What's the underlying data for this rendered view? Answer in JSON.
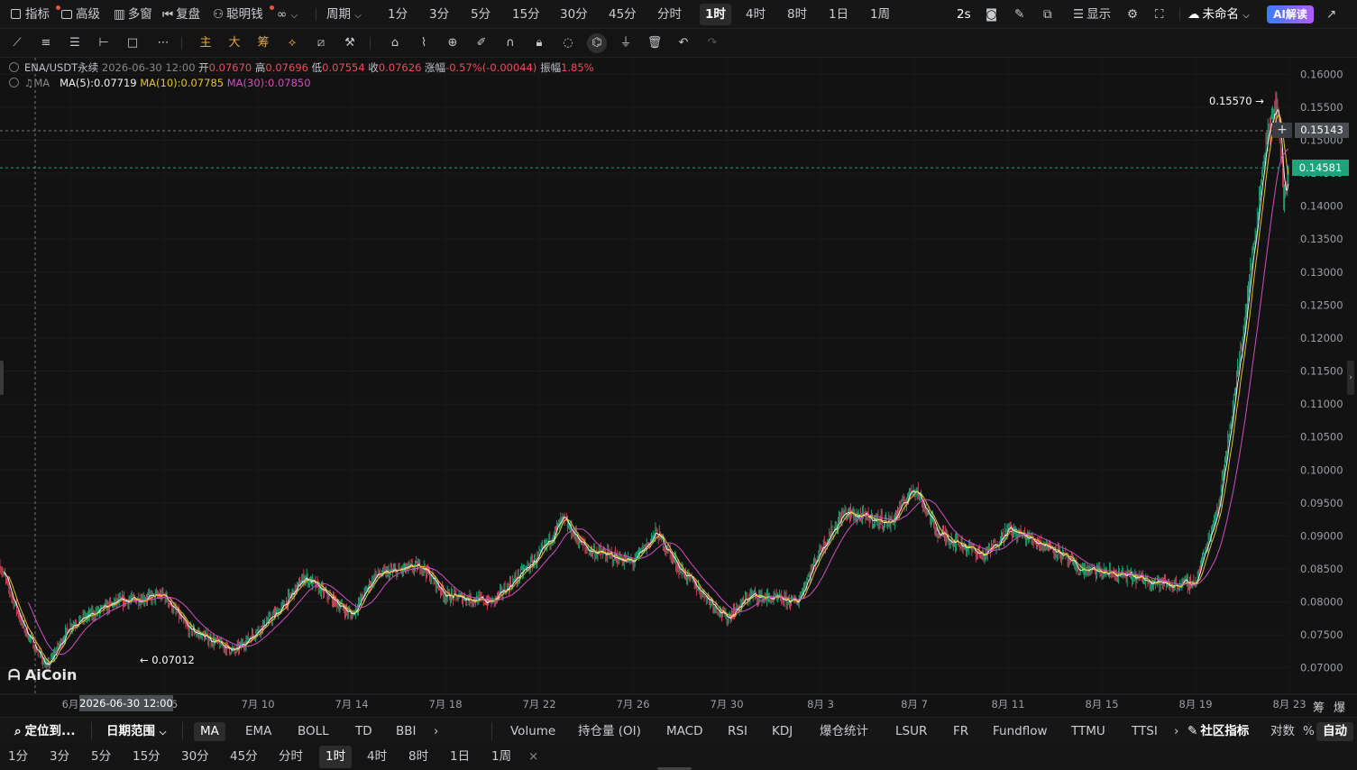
{
  "top": {
    "indicator": "指标",
    "advanced": "高级",
    "multi_window": "多窗",
    "replay": "复盘",
    "smart_money": "聪明钱",
    "smart_money_icon": "∞",
    "period_label": "周期",
    "periods": [
      "1分",
      "3分",
      "5分",
      "15分",
      "30分",
      "45分",
      "分时",
      "1时",
      "4时",
      "8时",
      "1日",
      "1周"
    ],
    "selected_period": "1时",
    "refresh": "2s",
    "display": "显示",
    "unnamed": "未命名",
    "ai_button": "AI解读"
  },
  "legend": {
    "pair": "ENA/USDT永续",
    "datetime": "2026-06-30 12:00",
    "open_label": "开",
    "open": "0.07670",
    "high_label": "高",
    "high": "0.07696",
    "low_label": "低",
    "low": "0.07554",
    "close_label": "收",
    "close": "0.07626",
    "change_label": "涨幅",
    "change": "-0.57%(-0.00044)",
    "amp_label": "振幅",
    "amp": "1.85%",
    "ma_label": "MA",
    "ma5": "MA(5):0.07719",
    "ma10": "MA(10):0.07785",
    "ma30": "MA(30):0.07850"
  },
  "price_axis": [
    "0.16000",
    "0.15500",
    "0.15000",
    "0.14500",
    "0.14000",
    "0.13500",
    "0.13000",
    "0.12500",
    "0.12000",
    "0.11500",
    "0.11000",
    "0.10500",
    "0.10000",
    "0.09500",
    "0.09000",
    "0.08500",
    "0.08000",
    "0.07500",
    "0.07000"
  ],
  "crosshair_price": "0.15143",
  "last_price": "0.14581",
  "high_marker": "0.15570 →",
  "low_marker": "← 0.07012",
  "crosshair_date": "2026-06-30 12:00",
  "date_axis": [
    "6月",
    "7月 6",
    "7月 10",
    "7月 14",
    "7月 18",
    "7月 22",
    "7月 26",
    "7月 30",
    "8月 3",
    "8月 7",
    "8月 11",
    "8月 15",
    "8月 19",
    "8月 23"
  ],
  "corner_labels": [
    "筹",
    "爆"
  ],
  "logo": "AiCoin",
  "colors": {
    "up": "#1fbf8e",
    "down": "#ea4d5a",
    "ma5": "#f0f0f0",
    "ma10": "#e6c229",
    "ma30": "#d04ec0",
    "last_price": "#1fa37a"
  },
  "chart_data": {
    "type": "candlestick",
    "interval": "1时",
    "x_range": [
      "2026-06-29",
      "2026-08-23"
    ],
    "ylim": [
      0.066,
      0.1625
    ],
    "price_path": [
      [
        "2026-06-29",
        0.0855
      ],
      [
        "2026-06-30",
        0.0762
      ],
      [
        "2026-07-01",
        0.0701
      ],
      [
        "2026-07-02",
        0.0765
      ],
      [
        "2026-07-04",
        0.08
      ],
      [
        "2026-07-06",
        0.081
      ],
      [
        "2026-07-07",
        0.076
      ],
      [
        "2026-07-09",
        0.0725
      ],
      [
        "2026-07-11",
        0.079
      ],
      [
        "2026-07-12",
        0.0838
      ],
      [
        "2026-07-14",
        0.078
      ],
      [
        "2026-07-15",
        0.084
      ],
      [
        "2026-07-17",
        0.0855
      ],
      [
        "2026-07-18",
        0.081
      ],
      [
        "2026-07-20",
        0.08
      ],
      [
        "2026-07-22",
        0.087
      ],
      [
        "2026-07-23",
        0.0925
      ],
      [
        "2026-07-24",
        0.088
      ],
      [
        "2026-07-26",
        0.086
      ],
      [
        "2026-07-27",
        0.0905
      ],
      [
        "2026-07-28",
        0.085
      ],
      [
        "2026-07-30",
        0.0775
      ],
      [
        "2026-07-31",
        0.081
      ],
      [
        "2026-08-02",
        0.08
      ],
      [
        "2026-08-03",
        0.088
      ],
      [
        "2026-08-04",
        0.0935
      ],
      [
        "2026-08-06",
        0.092
      ],
      [
        "2026-08-07",
        0.0975
      ],
      [
        "2026-08-08",
        0.0905
      ],
      [
        "2026-08-10",
        0.087
      ],
      [
        "2026-08-11",
        0.091
      ],
      [
        "2026-08-13",
        0.088
      ],
      [
        "2026-08-14",
        0.085
      ],
      [
        "2026-08-16",
        0.084
      ],
      [
        "2026-08-18",
        0.0825
      ],
      [
        "2026-08-19",
        0.083
      ],
      [
        "2026-08-20",
        0.095
      ],
      [
        "2026-08-21",
        0.12
      ],
      [
        "2026-08-22",
        0.15
      ],
      [
        "2026-08-22 12:00",
        0.1557
      ],
      [
        "2026-08-22 18:00",
        0.141
      ],
      [
        "2026-08-23",
        0.1458
      ]
    ]
  },
  "bottom1": {
    "locate": "定位到...",
    "date_range": "日期范围",
    "main_indicators": [
      "MA",
      "EMA",
      "BOLL",
      "TD",
      "BBI"
    ],
    "selected_main": "MA",
    "sub_indicators": [
      "Volume",
      "持仓量 (OI)",
      "MACD",
      "RSI",
      "KDJ",
      "爆仓统计",
      "LSUR",
      "FR",
      "Fundflow",
      "TTMU",
      "TTSI"
    ],
    "community": "社区指标",
    "log": "对数",
    "percent": "%",
    "auto": "自动"
  },
  "bottom2": {
    "periods": [
      "1分",
      "3分",
      "5分",
      "15分",
      "30分",
      "45分",
      "分时",
      "1时",
      "4时",
      "8时",
      "1日",
      "1周"
    ],
    "selected": "1时",
    "close": "×"
  }
}
